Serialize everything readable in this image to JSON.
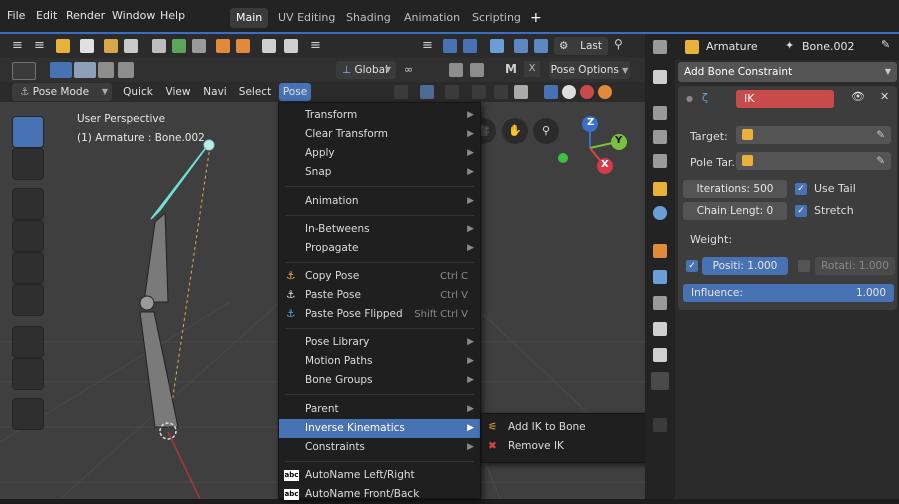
{
  "menubar": {
    "items": [
      "File",
      "Edit",
      "Render",
      "Window",
      "Help"
    ],
    "workspaces": [
      "Main",
      "UV Editing",
      "Shading",
      "Animation",
      "Scripting"
    ],
    "add_tab": "+"
  },
  "header": {
    "global_label": "Global",
    "last_label": "Last",
    "pose_options_label": "Pose Options"
  },
  "viewport_header": {
    "mode": "Pose Mode",
    "quick": "Quick",
    "view": "View",
    "navi": "Navi",
    "select": "Select",
    "pose": "Pose"
  },
  "viewport": {
    "perspective": "User Perspective",
    "object": "(1) Armature : Bone.002",
    "gizmo": {
      "x": "X",
      "y": "Y",
      "z": "Z"
    }
  },
  "pose_menu": {
    "transform": "Transform",
    "clear_transform": "Clear Transform",
    "apply": "Apply",
    "snap": "Snap",
    "animation": "Animation",
    "in_betweens": "In-Betweens",
    "propagate": "Propagate",
    "copy_pose": "Copy Pose",
    "copy_pose_sc": "Ctrl C",
    "paste_pose": "Paste Pose",
    "paste_pose_sc": "Ctrl V",
    "paste_flipped": "Paste Pose Flipped",
    "paste_flipped_sc": "Shift Ctrl V",
    "pose_library": "Pose Library",
    "motion_paths": "Motion Paths",
    "bone_groups": "Bone Groups",
    "parent": "Parent",
    "inverse_kinematics": "Inverse Kinematics",
    "constraints": "Constraints",
    "autoname_lr": "AutoName Left/Right",
    "autoname_fb": "AutoName Front/Back"
  },
  "ik_submenu": {
    "add_ik": "Add IK to Bone",
    "remove_ik": "Remove IK"
  },
  "properties": {
    "breadcrumb_armature": "Armature",
    "breadcrumb_bone": "Bone.002",
    "add_constraint": "Add Bone Constraint",
    "constraint_name": "IK",
    "target_label": "Target:",
    "pole_label": "Pole Tar..",
    "iterations": "Iterations: 500",
    "use_tail": "Use Tail",
    "chain_length": "Chain Lengt: 0",
    "stretch": "Stretch",
    "weight_label": "Weight:",
    "position": "Positi: 1.000",
    "rotation": "Rotati: 1.000",
    "influence_label": "Influence:",
    "influence_value": "1.000"
  }
}
